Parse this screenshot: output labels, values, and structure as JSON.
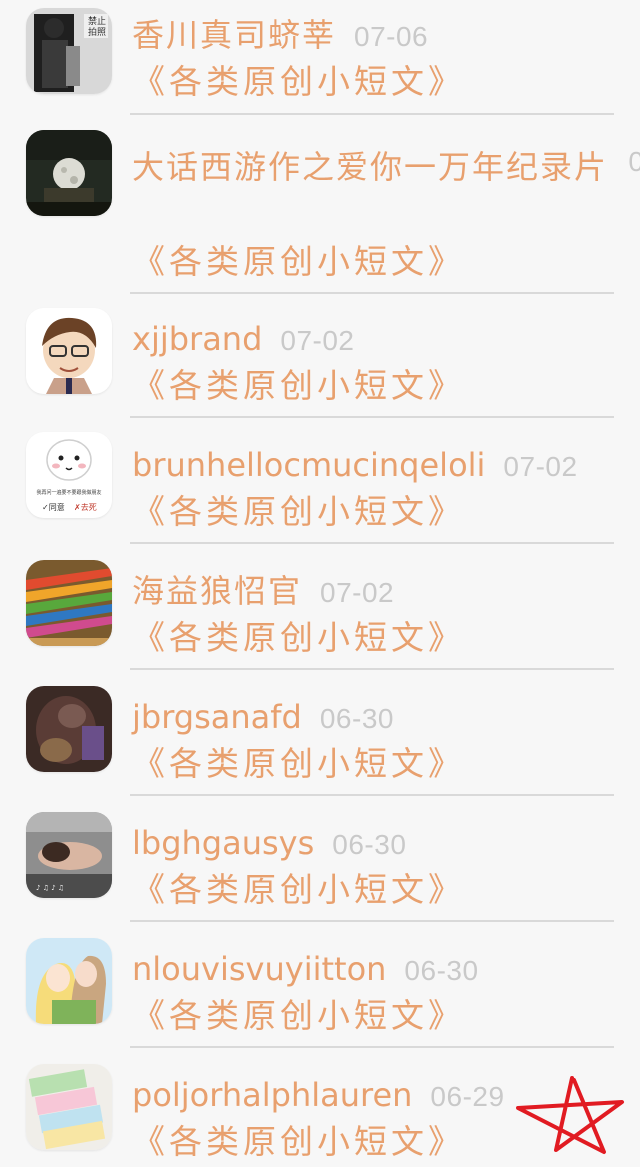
{
  "category_label": "《各类原创小短文》",
  "rows": [
    {
      "name": "香川真司蛴莘",
      "date": "07-06",
      "avatar": "avatar-dark-figure"
    },
    {
      "name": "大话西游作之爱你一万年纪录片",
      "date": "0",
      "avatar": "avatar-moon-scene"
    },
    {
      "name": "xjjbrand",
      "date": "07-02",
      "avatar": "avatar-cartoon-boy"
    },
    {
      "name": "brunhellocmucinqeloli",
      "date": "07-02",
      "avatar": "avatar-meme-face"
    },
    {
      "name": "海益狼怊官",
      "date": "07-02",
      "avatar": "avatar-color-pencils"
    },
    {
      "name": "jbrgsanafd",
      "date": "06-30",
      "avatar": "avatar-dark-art"
    },
    {
      "name": "lbghgausys",
      "date": "06-30",
      "avatar": "avatar-lying-girl"
    },
    {
      "name": "nlouvisvuyiitton",
      "date": "06-30",
      "avatar": "avatar-anime-couple"
    },
    {
      "name": "poljorhalphlauren",
      "date": "06-29",
      "avatar": "avatar-pastel-books"
    }
  ],
  "avatar_text": {
    "row1": "禁止\n拍照",
    "row4_caption": "我再问一遍要不要跟我做朋友",
    "row4_yes": "✓同意",
    "row4_no": "✗去死"
  },
  "colors": {
    "accent": "#e8a06e",
    "date": "#c9c9c9",
    "divider": "#d9d9d9",
    "background": "#f7f7f7",
    "annotation": "#e11b22"
  }
}
